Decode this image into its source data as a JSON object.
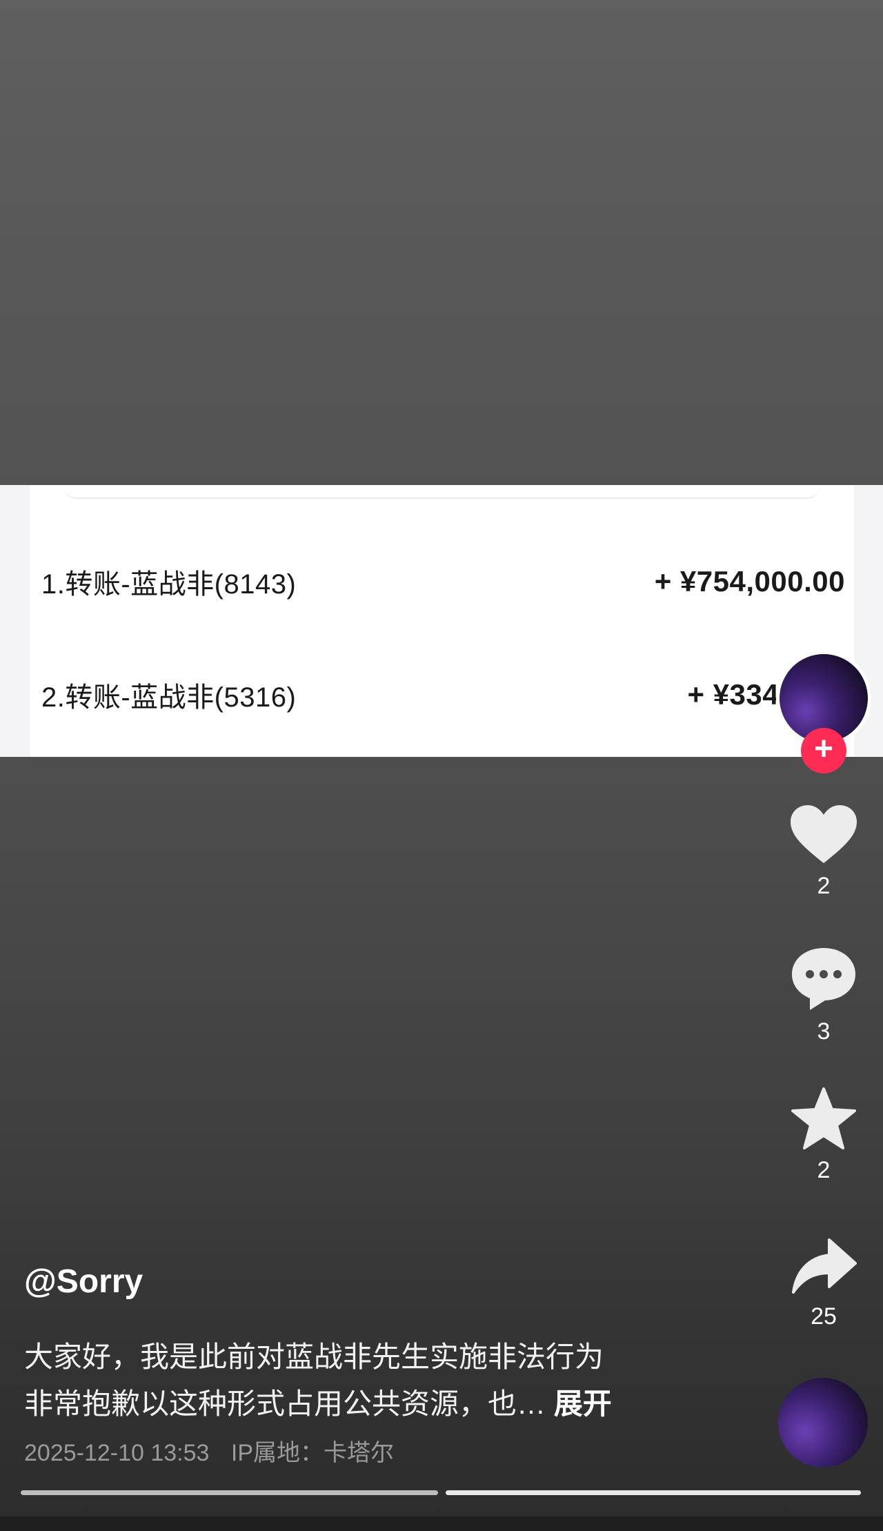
{
  "transactions": [
    {
      "label": "1.转账-蓝战非(8143)",
      "amount": "+ ¥754,000.00"
    },
    {
      "label": "2.转账-蓝战非(5316)",
      "amount": "+ ¥334,000."
    }
  ],
  "actions": {
    "follow_label": "+",
    "like_count": "2",
    "comment_count": "3",
    "favorite_count": "2",
    "share_count": "25"
  },
  "post": {
    "username": "@Sorry",
    "desc_line1": "大家好，我是此前对蓝战非先生实施非法行为",
    "desc_line2": "非常抱歉以这种形式占用公共资源，也…",
    "expand_label": "展开",
    "date": "2025-12-10 13:53",
    "ip_location": "IP属地：卡塔尔"
  },
  "icons": [
    "heart-icon",
    "comment-icon",
    "star-icon",
    "share-icon"
  ],
  "colors": {
    "follow": "#fe2c55",
    "avatar": "#3b2070"
  }
}
